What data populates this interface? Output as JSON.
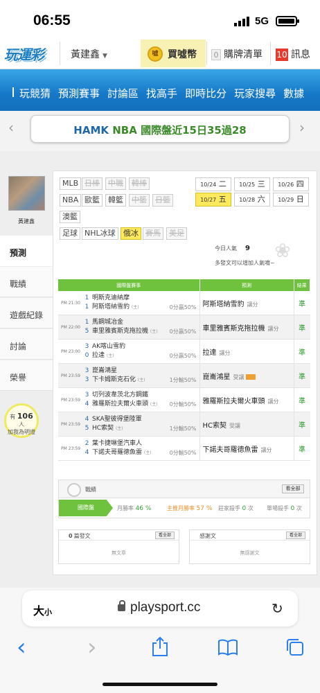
{
  "status_bar": {
    "time": "06:55",
    "network": "5G"
  },
  "topbar": {
    "logo": "玩運彩",
    "user": "黃建鑫",
    "coin_icon_text": "噓",
    "buy_coins": "買噓幣",
    "cart_count": "0",
    "cart_label": "購牌清單",
    "msg_count": "10",
    "msg_label": "訊息"
  },
  "nav": {
    "items": [
      "玩競猜",
      "預測賽事",
      "討論區",
      "找高手",
      "即時比分",
      "玩家搜尋",
      "數據"
    ]
  },
  "banner": {
    "text_hl": "HAMK",
    "text": "NBA 國際盤近15日35過28",
    "prev": "‹",
    "next": "›"
  },
  "sidebar": {
    "avatar_name": "黃建鑫",
    "items": [
      "預測",
      "戰績",
      "遊戲紀錄",
      "討論",
      "榮譽"
    ],
    "bulb_pre": "有",
    "bulb_count": "106",
    "bulb_unit": "人",
    "bulb_text": "加我為明燈"
  },
  "leagues": {
    "row1": [
      "MLB",
      "日棒",
      "中職",
      "韓棒"
    ],
    "row2": [
      "NBA",
      "歐籃",
      "韓籃",
      "中籃",
      "日籃"
    ],
    "row3": [
      "澳籃"
    ],
    "row4": [
      "足球",
      "NHL冰球",
      "俄冰",
      "賽馬",
      "美足"
    ]
  },
  "dates": [
    {
      "d": "10/24",
      "w": "二"
    },
    {
      "d": "10/25",
      "w": "三"
    },
    {
      "d": "10/26",
      "w": "四"
    },
    {
      "d": "10/27",
      "w": "五"
    },
    {
      "d": "10/28",
      "w": "六"
    },
    {
      "d": "10/29",
      "w": "日"
    }
  ],
  "popularity": {
    "label": "今日人氣",
    "value": "9",
    "hint": "多發文可以增加人氣唷~"
  },
  "table": {
    "headers": [
      "國際盤賽事",
      "預測",
      "結果"
    ],
    "rows": [
      {
        "time": "PM 21:30",
        "n1": "1",
        "t1": "明斯克迪納摩",
        "n2": "1",
        "t2": "阿斯塔納雪豹",
        "odds": "0分贏50%",
        "pick": "阿斯塔納雪豹",
        "type": "讓分",
        "res": "準"
      },
      {
        "time": "PM 22:00",
        "n1": "1",
        "t1": "馬鋼城冶金",
        "n2": "5",
        "t2": "車里雅賓斯克拖拉機",
        "odds": "0分贏50%",
        "pick": "車里雅賓斯克拖拉機",
        "type": "讓分",
        "res": "準"
      },
      {
        "time": "PM 23:00",
        "n1": "3",
        "t1": "AK喀山雪豹",
        "n2": "0",
        "t2": "拉達",
        "odds": "0分贏50%",
        "pick": "拉達",
        "type": "讓分",
        "res": "準"
      },
      {
        "time": "PM 23:59",
        "n1": "3",
        "t1": "崑崙鴻星",
        "n2": "3",
        "t2": "下卡姆斯克石化",
        "odds": "1分輸50%",
        "pick": "崑崙鴻星",
        "type": "受讓",
        "res": "準"
      },
      {
        "time": "PM 23:59",
        "n1": "3",
        "t1": "切列波韋茨北方鋼鐵",
        "n2": "4",
        "t2": "雅羅斯拉夫爾火車頭",
        "odds": "0分輸50%",
        "pick": "雅羅斯拉夫爾火車頭",
        "type": "讓分",
        "res": "準"
      },
      {
        "time": "PM 23:59",
        "n1": "4",
        "t1": "SKA聖彼得堡陸軍",
        "n2": "5",
        "t2": "HC索契",
        "odds": "1分輸50%",
        "pick": "HC索契",
        "type": "受讓",
        "res": "準"
      },
      {
        "time": "PM 23:59",
        "n1": "2",
        "t1": "葉卡捷琳堡汽車人",
        "n2": "4",
        "t2": "下諾夫哥羅德魚雷",
        "odds": "0分輸50%",
        "pick": "下諾夫哥羅德魚雷",
        "type": "讓分",
        "res": "準"
      }
    ]
  },
  "record": {
    "label": "戰績",
    "view_all": "看全部",
    "tab": "國際盤",
    "month_win_label": "月勝率",
    "month_win": "46 %",
    "main_month_label": "主推月勝率",
    "main_month": "57 %",
    "streak_label": "莊家殺手",
    "streak": "0",
    "streak_unit": "次",
    "single_label": "單場殺手",
    "single": "0",
    "single_unit": "次"
  },
  "posts": {
    "left_count": "0",
    "left_label": "篇發文",
    "left_btn": "看全部",
    "left_empty": "無文章",
    "right_label": "感謝文",
    "right_btn": "看全部",
    "right_empty": "無感謝文"
  },
  "browser": {
    "text_size": "大",
    "text_size_small": "小",
    "url": "playsport.cc",
    "reload": "↻"
  },
  "toolbar": {
    "back": "‹",
    "forward": "›"
  }
}
